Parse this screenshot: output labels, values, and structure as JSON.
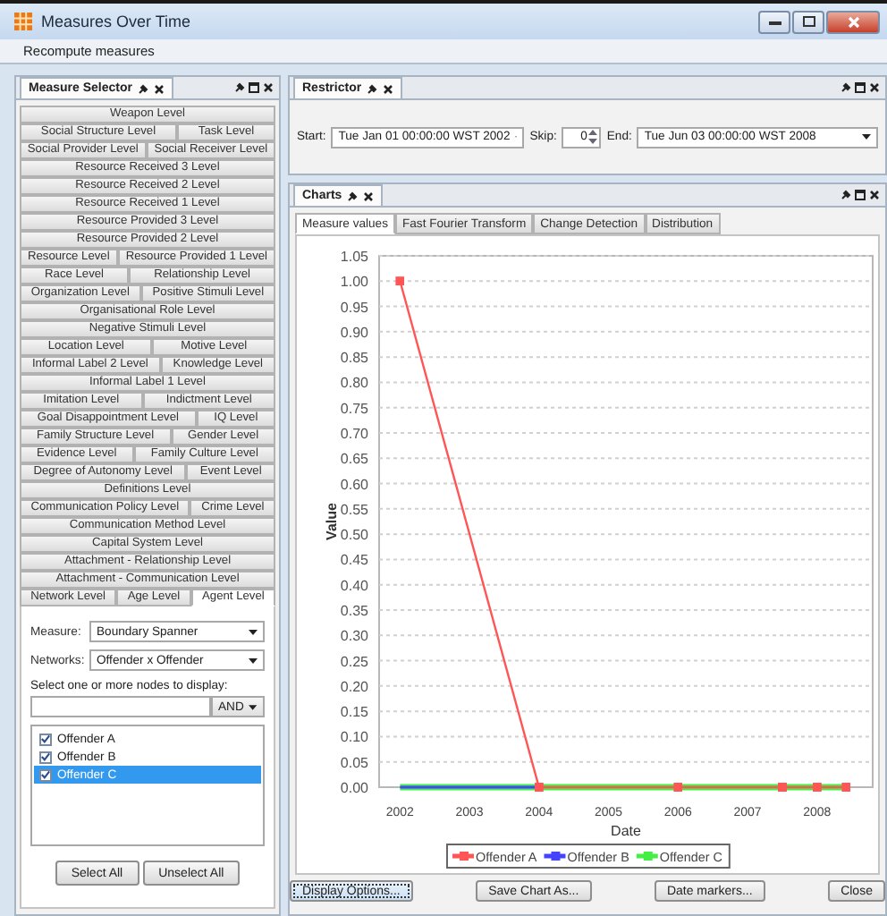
{
  "window": {
    "title": "Measures Over Time"
  },
  "toolbar": {
    "button": "Recompute measures"
  },
  "measure_selector": {
    "title": "Measure Selector",
    "level_rows": [
      {
        "tabs": [
          {
            "label": "Weapon Level",
            "selected": false
          }
        ]
      },
      {
        "tabs": [
          {
            "label": "Social Structure Level",
            "selected": false
          },
          {
            "label": "Task Level",
            "selected": false
          }
        ]
      },
      {
        "tabs": [
          {
            "label": "Social Provider Level",
            "selected": false
          },
          {
            "label": "Social Receiver Level",
            "selected": false
          }
        ]
      },
      {
        "tabs": [
          {
            "label": "Resource Received 3 Level",
            "selected": false
          }
        ]
      },
      {
        "tabs": [
          {
            "label": "Resource Received 2 Level",
            "selected": false
          }
        ]
      },
      {
        "tabs": [
          {
            "label": "Resource Received 1 Level",
            "selected": false
          }
        ]
      },
      {
        "tabs": [
          {
            "label": "Resource Provided 3 Level",
            "selected": false
          }
        ]
      },
      {
        "tabs": [
          {
            "label": "Resource Provided 2 Level",
            "selected": false
          }
        ]
      },
      {
        "tabs": [
          {
            "label": "Resource Level",
            "selected": false
          },
          {
            "label": "Resource Provided 1 Level",
            "selected": false
          }
        ]
      },
      {
        "tabs": [
          {
            "label": "Race Level",
            "selected": false
          },
          {
            "label": "Relationship Level",
            "selected": false
          }
        ]
      },
      {
        "tabs": [
          {
            "label": "Organization Level",
            "selected": false
          },
          {
            "label": "Positive Stimuli Level",
            "selected": false
          }
        ]
      },
      {
        "tabs": [
          {
            "label": "Organisational Role Level",
            "selected": false
          }
        ]
      },
      {
        "tabs": [
          {
            "label": "Negative Stimuli Level",
            "selected": false
          }
        ]
      },
      {
        "tabs": [
          {
            "label": "Location Level",
            "selected": false
          },
          {
            "label": "Motive Level",
            "selected": false
          }
        ]
      },
      {
        "tabs": [
          {
            "label": "Informal Label 2 Level",
            "selected": false
          },
          {
            "label": "Knowledge Level",
            "selected": false
          }
        ]
      },
      {
        "tabs": [
          {
            "label": "Informal Label 1 Level",
            "selected": false
          }
        ]
      },
      {
        "tabs": [
          {
            "label": "Imitation Level",
            "selected": false
          },
          {
            "label": "Indictment Level",
            "selected": false
          }
        ]
      },
      {
        "tabs": [
          {
            "label": "Goal Disappointment Level",
            "selected": false
          },
          {
            "label": "IQ Level",
            "selected": false
          }
        ]
      },
      {
        "tabs": [
          {
            "label": "Family Structure Level",
            "selected": false
          },
          {
            "label": "Gender Level",
            "selected": false
          }
        ]
      },
      {
        "tabs": [
          {
            "label": "Evidence Level",
            "selected": false
          },
          {
            "label": "Family Culture Level",
            "selected": false
          }
        ]
      },
      {
        "tabs": [
          {
            "label": "Degree of Autonomy Level",
            "selected": false
          },
          {
            "label": "Event Level",
            "selected": false
          }
        ]
      },
      {
        "tabs": [
          {
            "label": "Definitions Level",
            "selected": false
          }
        ]
      },
      {
        "tabs": [
          {
            "label": "Communication Policy Level",
            "selected": false
          },
          {
            "label": "Crime Level",
            "selected": false
          }
        ]
      },
      {
        "tabs": [
          {
            "label": "Communication Method Level",
            "selected": false
          }
        ]
      },
      {
        "tabs": [
          {
            "label": "Capital System Level",
            "selected": false
          }
        ]
      },
      {
        "tabs": [
          {
            "label": "Attachment - Relationship Level",
            "selected": false
          }
        ]
      },
      {
        "tabs": [
          {
            "label": "Attachment - Communication Level",
            "selected": false
          }
        ]
      },
      {
        "tabs": [
          {
            "label": "Network Level",
            "selected": false
          },
          {
            "label": "Age Level",
            "selected": false
          },
          {
            "label": "Agent Level",
            "selected": true
          }
        ]
      }
    ],
    "measure": {
      "label": "Measure:",
      "value": "Boundary Spanner"
    },
    "networks": {
      "label": "Networks:",
      "value": "Offender x Offender"
    },
    "nodes_prompt": "Select one or more nodes to display:",
    "filter_mode": "AND",
    "nodes": [
      {
        "label": "Offender A",
        "checked": true,
        "selected": false
      },
      {
        "label": "Offender B",
        "checked": true,
        "selected": false
      },
      {
        "label": "Offender C",
        "checked": true,
        "selected": true
      }
    ],
    "buttons": [
      "Select All",
      "Unselect All"
    ]
  },
  "restrictor": {
    "title": "Restrictor",
    "start": {
      "label": "Start:",
      "value": "Tue Jan 01 00:00:00 WST 2002"
    },
    "skip": {
      "label": "Skip:",
      "value": "0"
    },
    "end": {
      "label": "End:",
      "value": "Tue Jun 03 00:00:00 WST 2008"
    }
  },
  "charts": {
    "title": "Charts",
    "tabs": [
      {
        "label": "Measure values",
        "selected": true
      },
      {
        "label": "Fast Fourier Transform",
        "selected": false
      },
      {
        "label": "Change Detection",
        "selected": false
      },
      {
        "label": "Distribution",
        "selected": false
      }
    ],
    "chart_data": {
      "type": "line",
      "xlabel": "Date",
      "ylabel": "Value",
      "x": [
        2002,
        2004,
        2006,
        2007.5,
        2008,
        2008.42
      ],
      "series": [
        {
          "name": "Offender A",
          "color": "#ff5555",
          "values": [
            1,
            0,
            0,
            0,
            0,
            0
          ]
        },
        {
          "name": "Offender B",
          "color": "#4444ff",
          "values": [
            0,
            0,
            null,
            null,
            null,
            null
          ]
        },
        {
          "name": "Offender C",
          "color": "#44ee44",
          "values": [
            0,
            0,
            0,
            0,
            0,
            0
          ]
        }
      ],
      "xlim": [
        2001.7,
        2008.8
      ],
      "ylim": [
        0,
        1.05
      ],
      "grid": true,
      "legend": true,
      "xticks": [
        2002,
        2003,
        2004,
        2005,
        2006,
        2007,
        2008
      ],
      "yticks": [
        {
          "value": 0,
          "label": "0.00"
        },
        {
          "value": 0.05,
          "label": "0.05"
        },
        {
          "value": 0.1,
          "label": "0.10"
        },
        {
          "value": 0.15,
          "label": "0.15"
        },
        {
          "value": 0.2,
          "label": "0.20"
        },
        {
          "value": 0.25,
          "label": "0.25"
        },
        {
          "value": 0.3,
          "label": "0.30"
        },
        {
          "value": 0.35,
          "label": "0.35"
        },
        {
          "value": 0.4,
          "label": "0.40"
        },
        {
          "value": 0.45,
          "label": "0.45"
        },
        {
          "value": 0.5,
          "label": "0.50"
        },
        {
          "value": 0.55,
          "label": "0.55"
        },
        {
          "value": 0.6,
          "label": "0.60"
        },
        {
          "value": 0.65,
          "label": "0.65"
        },
        {
          "value": 0.7,
          "label": "0.70"
        },
        {
          "value": 0.75,
          "label": "0.75"
        },
        {
          "value": 0.8,
          "label": "0.80"
        },
        {
          "value": 0.85,
          "label": "0.85"
        },
        {
          "value": 0.9,
          "label": "0.90"
        },
        {
          "value": 0.95,
          "label": "0.95"
        },
        {
          "value": 1,
          "label": "1.00"
        },
        {
          "value": 1.05,
          "label": "1.05"
        }
      ]
    },
    "buttons": [
      "Display Options...",
      "Save Chart As...",
      "Date markers...",
      "Close"
    ]
  }
}
